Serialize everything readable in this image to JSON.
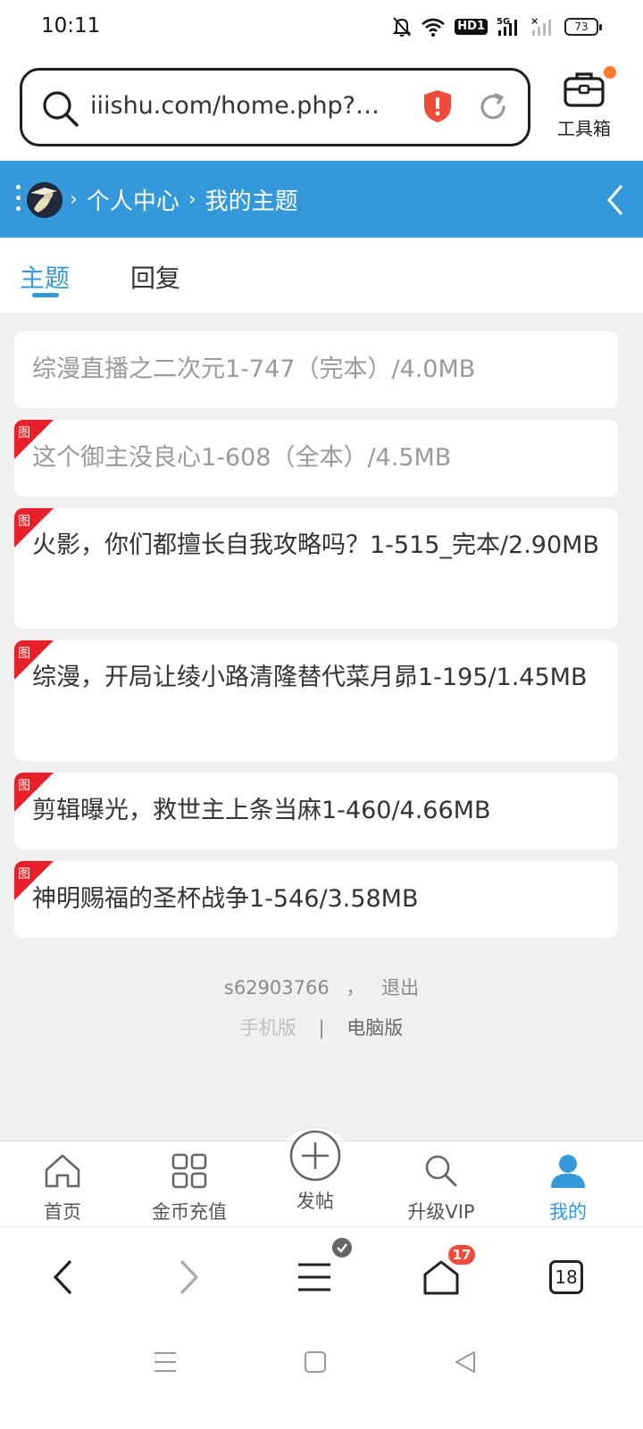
{
  "status_bar": {
    "time": "10:11",
    "network": "5G",
    "hd": "HD1",
    "battery": "73"
  },
  "browser": {
    "url": "iiishu.com/home.php?mod=space&uid=...",
    "toolbox_label": "工具箱"
  },
  "header": {
    "breadcrumb": [
      "个人中心",
      "我的主题"
    ]
  },
  "tabs": [
    {
      "label": "主题"
    },
    {
      "label": "回复"
    }
  ],
  "threads": [
    {
      "title": "综漫直播之二次元1-747（完本）/4.0MB"
    },
    {
      "title": "这个御主没良心1-608（全本）/4.5MB"
    },
    {
      "title": "火影，你们都擅长自我攻略吗？1-515_完本/2.90MB"
    },
    {
      "title": "综漫，开局让绫小路清隆替代菜月昴1-195/1.45MB"
    },
    {
      "title": "剪辑曝光，救世主上条当麻1-460/4.66MB"
    },
    {
      "title": "神明赐福的圣杯战争1-546/3.58MB"
    }
  ],
  "image_tag": "图",
  "footer": {
    "username": "s62903766",
    "separator": "，",
    "logout": "退出",
    "mobile": "手机版",
    "pipe": "|",
    "desktop": "电脑版"
  },
  "bottom_nav": [
    {
      "label": "首页"
    },
    {
      "label": "金币充值"
    },
    {
      "label": "发帖"
    },
    {
      "label": "升级VIP"
    },
    {
      "label": "我的"
    }
  ],
  "browser_toolbar": {
    "home_badge": "17",
    "tab_count": "18"
  },
  "colors": {
    "accent": "#3499db",
    "badge": "#f04a3a",
    "tag_red": "#e8202a"
  }
}
